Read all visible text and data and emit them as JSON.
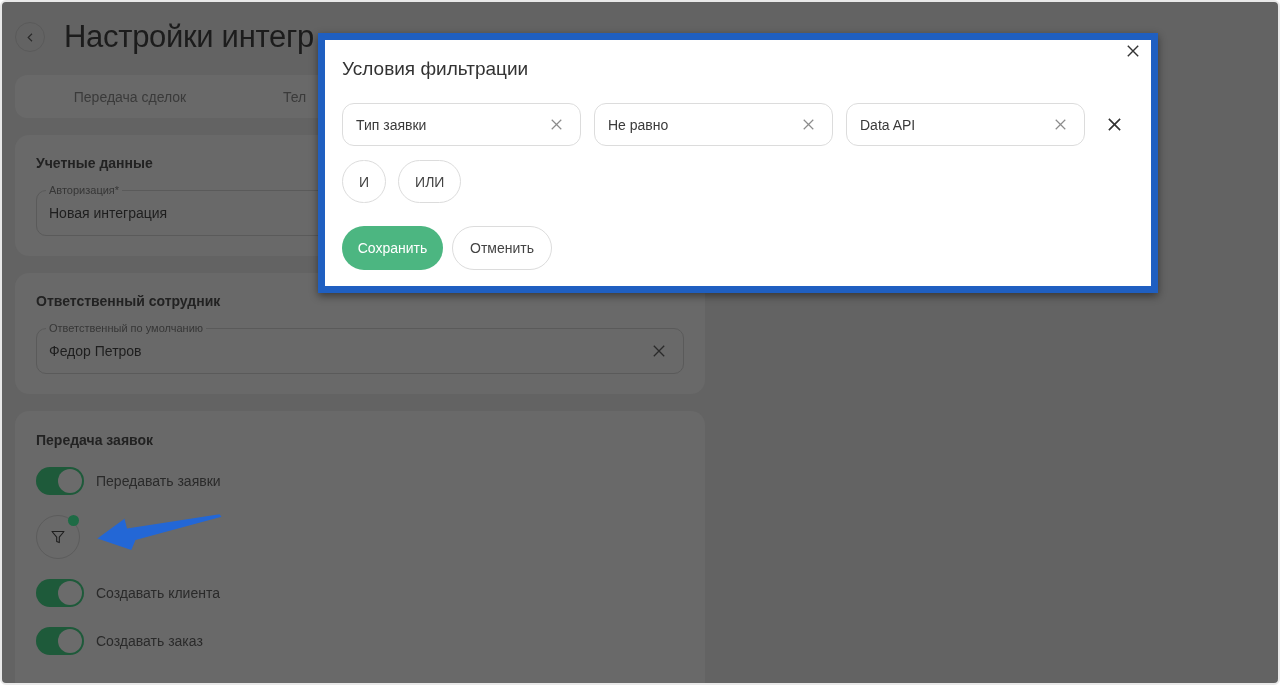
{
  "page": {
    "title": "Настройки интегр",
    "tabs": [
      "Передача сделок",
      "Тел"
    ]
  },
  "credentials": {
    "title": "Учетные данные",
    "field": {
      "label": "Авторизация*",
      "value": "Новая интеграция"
    }
  },
  "responsible": {
    "title": "Ответственный сотрудник",
    "field": {
      "label": "Ответственный по умолчанию",
      "value": "Федор Петров",
      "clearable": true
    }
  },
  "requests": {
    "title": "Передача заявок",
    "items": [
      {
        "kind": "toggle",
        "label": "Передавать заявки",
        "on": true
      },
      {
        "kind": "filter",
        "active": true
      },
      {
        "kind": "toggle",
        "label": "Создавать клиента",
        "on": true
      },
      {
        "kind": "toggle",
        "label": "Создавать заказ",
        "on": true
      }
    ]
  },
  "filter_dialog": {
    "title": "Условия фильтрации",
    "conditions": [
      {
        "value": "Тип заявки"
      },
      {
        "value": "Не равно"
      },
      {
        "value": "Data API"
      }
    ],
    "logic_buttons": [
      "И",
      "ИЛИ"
    ],
    "buttons": [
      {
        "label": "Сохранить",
        "kind": "primary"
      },
      {
        "label": "Отменить",
        "kind": "secondary"
      }
    ]
  }
}
